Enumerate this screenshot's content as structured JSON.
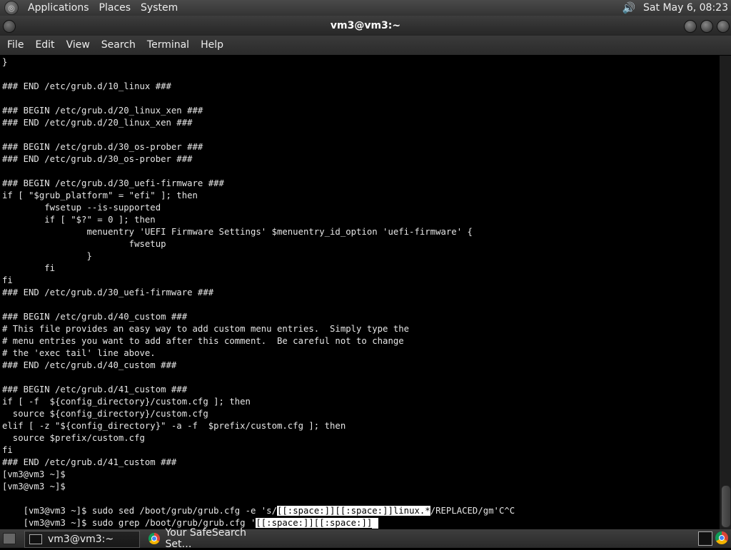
{
  "top_panel": {
    "menus": [
      "Applications",
      "Places",
      "System"
    ],
    "clock": "Sat May  6, 08:23"
  },
  "window": {
    "title": "vm3@vm3:~"
  },
  "menubar": [
    "File",
    "Edit",
    "View",
    "Search",
    "Terminal",
    "Help"
  ],
  "terminal": {
    "lines": [
      "}",
      "",
      "### END /etc/grub.d/10_linux ###",
      "",
      "### BEGIN /etc/grub.d/20_linux_xen ###",
      "### END /etc/grub.d/20_linux_xen ###",
      "",
      "### BEGIN /etc/grub.d/30_os-prober ###",
      "### END /etc/grub.d/30_os-prober ###",
      "",
      "### BEGIN /etc/grub.d/30_uefi-firmware ###",
      "if [ \"$grub_platform\" = \"efi\" ]; then",
      "        fwsetup --is-supported",
      "        if [ \"$?\" = 0 ]; then",
      "                menuentry 'UEFI Firmware Settings' $menuentry_id_option 'uefi-firmware' {",
      "                        fwsetup",
      "                }",
      "        fi",
      "fi",
      "### END /etc/grub.d/30_uefi-firmware ###",
      "",
      "### BEGIN /etc/grub.d/40_custom ###",
      "# This file provides an easy way to add custom menu entries.  Simply type the",
      "# menu entries you want to add after this comment.  Be careful not to change",
      "# the 'exec tail' line above.",
      "### END /etc/grub.d/40_custom ###",
      "",
      "### BEGIN /etc/grub.d/41_custom ###",
      "if [ -f  ${config_directory}/custom.cfg ]; then",
      "  source ${config_directory}/custom.cfg",
      "elif [ -z \"${config_directory}\" -a -f  $prefix/custom.cfg ]; then",
      "  source $prefix/custom.cfg",
      "fi",
      "### END /etc/grub.d/41_custom ###",
      "[vm3@vm3 ~]$",
      "[vm3@vm3 ~]$"
    ],
    "sed_line": {
      "prefix": "[vm3@vm3 ~]$ sudo sed /boot/grub/grub.cfg -e 's/",
      "highlight": "[[:space:]][[:space:]]linux.*",
      "suffix": "/REPLACED/gm'C^C"
    },
    "grep_line": {
      "prefix": "[vm3@vm3 ~]$ sudo grep /boot/grub/grub.cfg '",
      "highlight": "[[:space:]][[:space:]]"
    }
  },
  "taskbar": {
    "tasks": [
      {
        "label": "vm3@vm3:~",
        "icon": "terminal-icon",
        "active": true
      },
      {
        "label": "Your SafeSearch Set…",
        "icon": "chrome-icon",
        "active": false
      }
    ]
  }
}
